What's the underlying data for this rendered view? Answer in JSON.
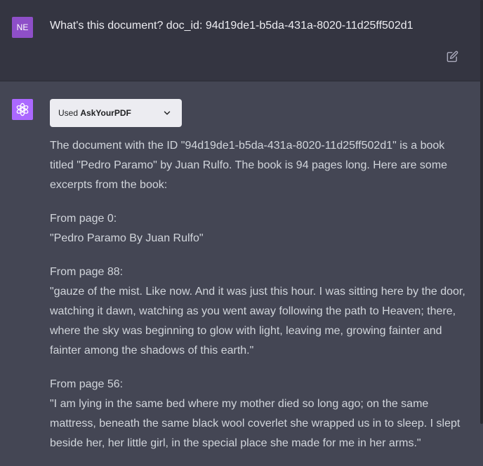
{
  "user_message": {
    "avatar_initials": "NE",
    "text": "What's this document? doc_id: 94d19de1-b5da-431a-8020-11d25ff502d1",
    "edit_icon": "edit-icon"
  },
  "assistant_message": {
    "avatar_icon": "openai-logo-icon",
    "plugin": {
      "prefix": "Used",
      "name": "AskYourPDF",
      "chevron_icon": "chevron-down-icon"
    },
    "intro": "The document with the ID \"94d19de1-b5da-431a-8020-11d25ff502d1\" is a book titled \"Pedro Paramo\" by Juan Rulfo. The book is 94 pages long. Here are some excerpts from the book:",
    "excerpts": [
      {
        "page_label": "From page 0:",
        "text": "\"Pedro Paramo By Juan Rulfo\""
      },
      {
        "page_label": "From page 88:",
        "text": "\"gauze of the mist. Like now. And it was just this hour. I was sitting here by the door, watching it dawn, watching as you went away following the path to Heaven; there, where the sky was beginning to glow with light, leaving me, growing fainter and fainter among the shadows of this earth.\""
      },
      {
        "page_label": "From page 56:",
        "text": "\"I am lying in the same bed where my mother died so long ago; on the same mattress, beneath the same black wool coverlet she wrapped us in to sleep. I slept beside her, her little girl, in the special place she made for me in her arms.\""
      }
    ]
  },
  "colors": {
    "user_bg": "#343541",
    "assistant_bg": "#444654",
    "user_avatar": "#8e4fc8",
    "bot_avatar": "#ab68ff",
    "text": "#d1d5db"
  }
}
